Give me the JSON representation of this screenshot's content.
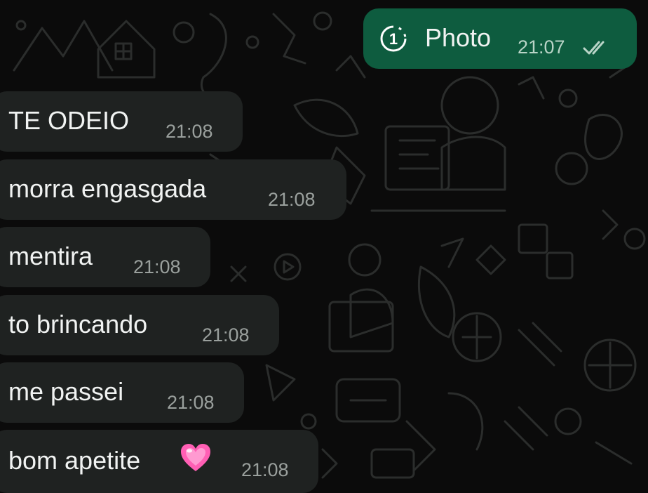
{
  "outgoing": {
    "icon": "view-once-icon",
    "icon_glyph": "1",
    "label": "Photo",
    "time": "21:07",
    "status": "double-check-read-icon"
  },
  "incoming": [
    {
      "text": "TE ODEIO",
      "time": "21:08"
    },
    {
      "text": "morra engasgada",
      "time": "21:08"
    },
    {
      "text": "mentira",
      "time": "21:08"
    },
    {
      "text": "to brincando",
      "time": "21:08"
    },
    {
      "text": "me passei",
      "time": "21:08"
    },
    {
      "text": "bom apetite",
      "emoji": "heart-emoji",
      "time": "21:08"
    }
  ],
  "colors": {
    "background": "#0b0b0b",
    "incoming_bubble": "#1f2221",
    "outgoing_bubble": "#0e5c3f",
    "heart": "#ff5fb4"
  }
}
